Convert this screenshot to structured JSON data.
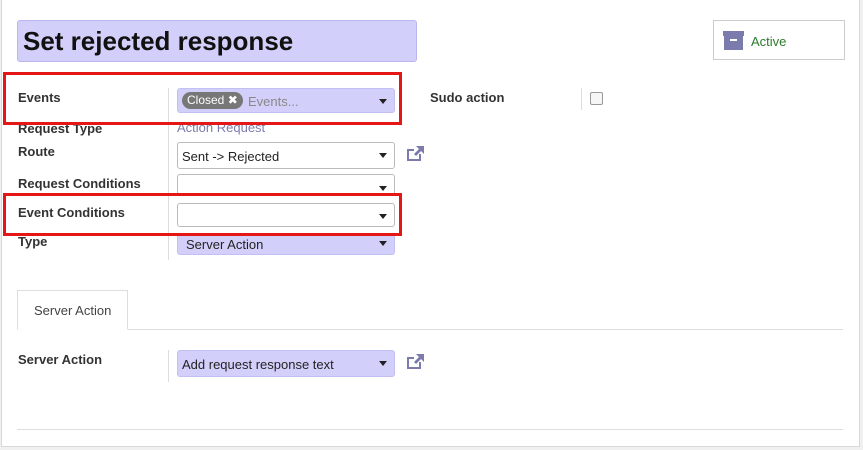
{
  "title": "Set rejected response",
  "status_button": {
    "label": "Active",
    "icon": "archive-icon"
  },
  "fields": {
    "events": {
      "label": "Events",
      "tag": "Closed",
      "placeholder": "Events..."
    },
    "sudo_action": {
      "label": "Sudo action",
      "checked": false
    },
    "request_type": {
      "label": "Request Type",
      "value": "Action Request"
    },
    "route": {
      "label": "Route",
      "value": "Sent -> Rejected"
    },
    "request_conditions": {
      "label": "Request Conditions",
      "value": ""
    },
    "event_conditions": {
      "label": "Event Conditions",
      "value": ""
    },
    "type": {
      "label": "Type",
      "value": "Server Action"
    }
  },
  "tabs": [
    {
      "label": "Server Action",
      "active": true
    }
  ],
  "server_action": {
    "label": "Server Action",
    "value": "Add request response text"
  },
  "colors": {
    "required_bg": "#d2d0fa",
    "highlight": "#e41616",
    "accent": "#7c7bad"
  }
}
